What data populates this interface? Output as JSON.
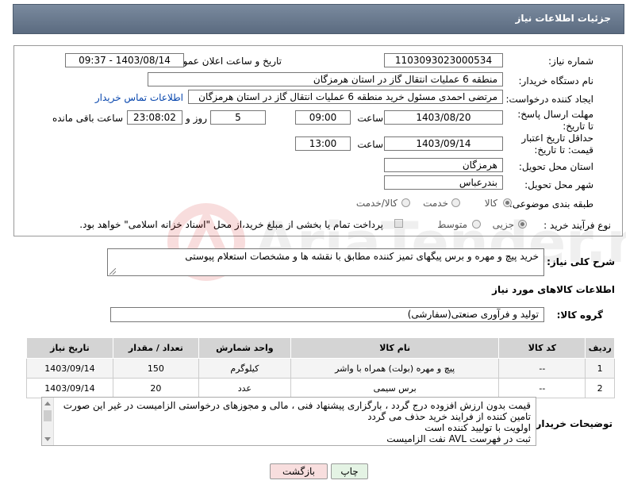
{
  "header": {
    "title": "جزئیات اطلاعات نیاز"
  },
  "form": {
    "need_number_label": "شماره نیاز:",
    "need_number": "1103093023000534",
    "announce_label": "تاریخ و ساعت اعلان عمومی:",
    "announce_value": "1403/08/14 - 09:37",
    "buyer_label": "نام دستگاه خریدار:",
    "buyer_value": "منطقه 6 عملیات انتقال گاز در استان هرمزگان",
    "requester_label": "ایجاد کننده درخواست:",
    "requester_value": "مرتضی احمدی مسئول خرید منطقه 6 عملیات انتقال گاز در استان هرمزگان",
    "contact_link": "اطلاعات تماس خریدار",
    "deadline_label": "مهلت ارسال پاسخ: تا تاریخ:",
    "deadline_date": "1403/08/20",
    "time_label": "ساعت",
    "deadline_time": "09:00",
    "days_value": "5",
    "days_label": "روز و",
    "remaining_time": "23:08:02",
    "remaining_label": "ساعت باقی مانده",
    "validity_label": "حداقل تاریخ اعتبار قیمت: تا تاریخ:",
    "validity_date": "1403/09/14",
    "validity_time": "13:00",
    "province_label": "استان محل تحویل:",
    "province_value": "هرمزگان",
    "city_label": "شهر محل تحویل:",
    "city_value": "بندرعباس",
    "category_label": "طبقه بندی موضوعی:",
    "category_options": [
      "کالا",
      "خدمت",
      "کالا/خدمت"
    ],
    "category_selected": "کالا",
    "process_label": "نوع فرآیند خرید :",
    "process_options": [
      "جزیی",
      "متوسط"
    ],
    "process_selected": "جزیی",
    "payment_note": "پرداخت تمام یا بخشی از مبلغ خرید،از محل \"اسناد خزانه اسلامی\" خواهد بود."
  },
  "description": {
    "label": "شرح کلی نیاز:",
    "value": "خرید پیچ و مهره و برس پیگهای تمیز کننده مطابق با نقشه ها و مشخصات استعلام پیوستی"
  },
  "goods_section": {
    "title": "اطلاعات کالاهای مورد نیاز",
    "group_label": "گروه کالا:",
    "group_value": "تولید و فرآوری صنعتی(سفارشی)"
  },
  "table": {
    "headers": [
      "ردیف",
      "کد کالا",
      "نام کالا",
      "واحد شمارش",
      "تعداد / مقدار",
      "تاریخ نیاز"
    ],
    "rows": [
      [
        "1",
        "--",
        "پیچ و مهره (بولت) همراه با واشر",
        "کیلوگرم",
        "150",
        "1403/09/14"
      ],
      [
        "2",
        "--",
        "برس سیمی",
        "عدد",
        "20",
        "1403/09/14"
      ]
    ]
  },
  "notes": {
    "label": "توضیحات خریدار:",
    "lines": [
      "قیمت بدون ارزش افزوده درج گردد ، بارگزاری پیشنهاد فنی ، مالی و مجوزهای درخواستی الزامیست در غیر این صورت",
      "تامین کننده از فرایند خرید حذف می گردد",
      "اولویت با تولیید کننده است",
      "ثبت در فهرست AVL  نفت الزامیست"
    ]
  },
  "buttons": {
    "print": "چاپ",
    "back": "بازگشت"
  },
  "watermark_text": "AriaTender.net",
  "colors": {
    "header": "#5b6b80",
    "link": "#0645ad",
    "back_button": "#f8dede",
    "print_button": "#e4f3e4"
  }
}
